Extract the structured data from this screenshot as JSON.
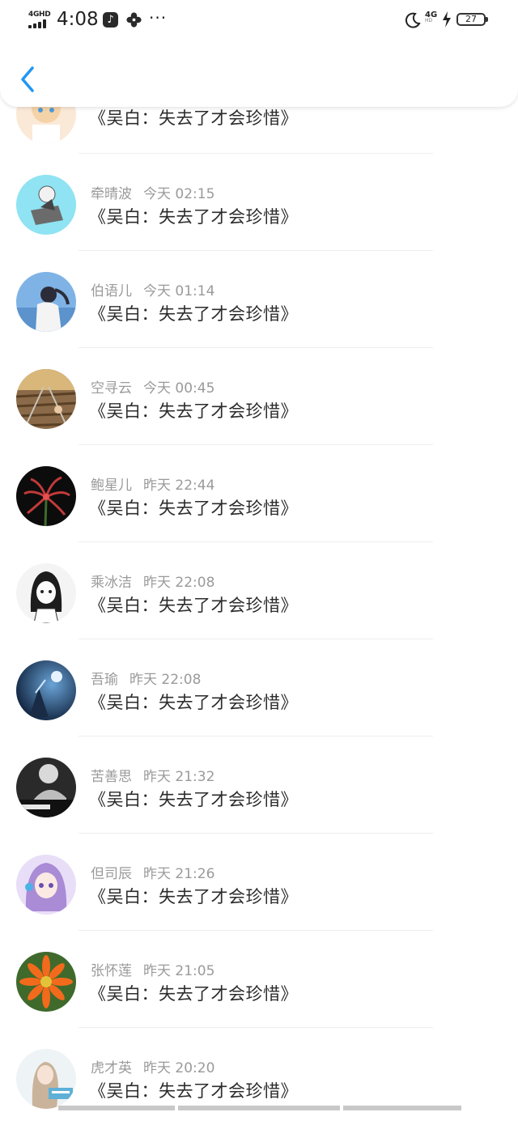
{
  "status_bar": {
    "network_label": "4GHD",
    "time": "4:08",
    "app_icons": [
      "tiktok-icon",
      "fan-icon"
    ],
    "more": "···",
    "network_type": "4G",
    "network_sub": "HD",
    "battery": "27"
  },
  "header": {
    "back_icon": "chevron-left-icon",
    "accent_color": "#2196F3"
  },
  "rows": [
    {
      "name": "",
      "time": "",
      "title": "《吴白：失去了才会珍惜》",
      "avatar_icon": "anime-girl-avatar"
    },
    {
      "name": "牵晴波",
      "time": "今天 02:15",
      "title": "《吴白：失去了才会珍惜》",
      "avatar_icon": "anime-boy-avatar"
    },
    {
      "name": "伯语儿",
      "time": "今天 01:14",
      "title": "《吴白：失去了才会珍惜》",
      "avatar_icon": "girl-photo-avatar"
    },
    {
      "name": "空寻云",
      "time": "今天 00:45",
      "title": "《吴白：失去了才会珍惜》",
      "avatar_icon": "railway-avatar"
    },
    {
      "name": "鲍星儿",
      "time": "昨天 22:44",
      "title": "《吴白：失去了才会珍惜》",
      "avatar_icon": "red-flower-avatar"
    },
    {
      "name": "乘冰洁",
      "time": "昨天 22:08",
      "title": "《吴白：失去了才会珍惜》",
      "avatar_icon": "manga-girl-avatar"
    },
    {
      "name": "吾瑜",
      "time": "昨天 22:08",
      "title": "《吴白：失去了才会珍惜》",
      "avatar_icon": "night-sky-avatar"
    },
    {
      "name": "苦善思",
      "time": "昨天 21:32",
      "title": "《吴白：失去了才会珍惜》",
      "avatar_icon": "bw-photo-avatar"
    },
    {
      "name": "但司辰",
      "time": "昨天 21:26",
      "title": "《吴白：失去了才会珍惜》",
      "avatar_icon": "purple-anime-avatar"
    },
    {
      "name": "张怀莲",
      "time": "昨天 21:05",
      "title": "《吴白：失去了才会珍惜》",
      "avatar_icon": "orange-flower-avatar"
    },
    {
      "name": "虎才英",
      "time": "昨天 20:20",
      "title": "《吴白：失去了才会珍惜》",
      "avatar_icon": "girl-sketch-avatar"
    }
  ]
}
